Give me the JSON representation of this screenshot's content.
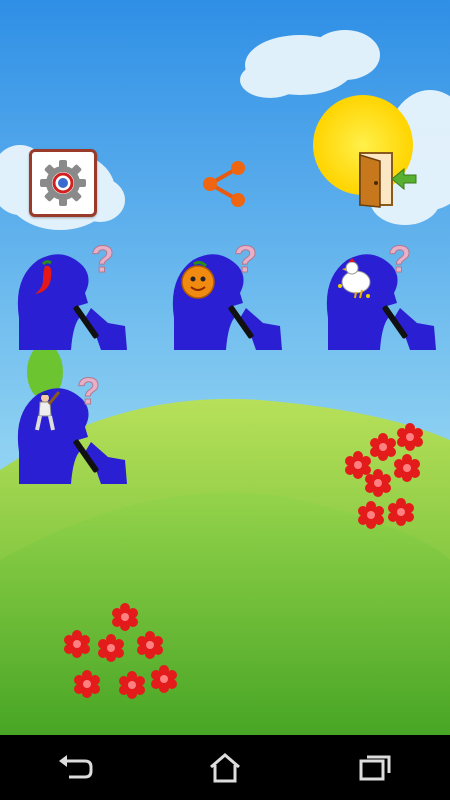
{
  "app": {
    "toolbar": {
      "settings": {
        "icon": "gear-icon"
      },
      "share": {
        "icon": "share-icon",
        "color": "#ee6611"
      },
      "exit": {
        "icon": "exit-door-icon"
      }
    },
    "puzzles": [
      {
        "icon": "chili-pepper-icon",
        "question_mark": "?"
      },
      {
        "icon": "orange-fruit-icon",
        "question_mark": "?"
      },
      {
        "icon": "chicken-icon",
        "question_mark": "?"
      },
      {
        "icon": "baseball-player-icon",
        "question_mark": "?"
      }
    ],
    "colors": {
      "head": "#2b1fd4",
      "question_mark": "#e8b0c8",
      "flower": "#e31b1b",
      "sky_top": "#3b97e8",
      "grass": "#6cc23a"
    }
  },
  "nav": {
    "back": {
      "icon": "back-icon"
    },
    "home": {
      "icon": "home-icon"
    },
    "recents": {
      "icon": "recent-apps-icon"
    }
  }
}
